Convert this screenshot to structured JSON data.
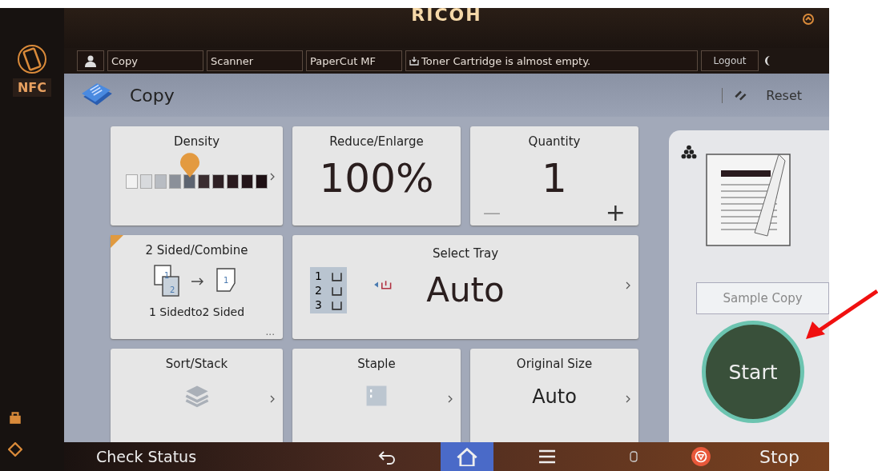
{
  "brand": "RICOH",
  "nfc": {
    "label": "NFC"
  },
  "header": {
    "tabs": [
      {
        "label": "Copy",
        "selected": false
      },
      {
        "label": "Scanner",
        "selected": false
      },
      {
        "label": "PaperCut MF",
        "selected": false
      }
    ],
    "message": "Toner Cartridge is almost empty.",
    "logout": "Logout"
  },
  "title": "Copy",
  "reset": "Reset",
  "tiles": [
    {
      "kind": "density",
      "label": "Density",
      "level": 0.45
    },
    {
      "kind": "zoom",
      "label": "Reduce/Enlarge",
      "value": "100%"
    },
    {
      "kind": "quantity",
      "label": "Quantity",
      "value": "1",
      "minus": "—",
      "plus": "+"
    },
    {
      "kind": "duplex",
      "label": "2 Sided/Combine",
      "value": "1 Sidedto2 Sided",
      "pages": [
        "1",
        "2",
        "1"
      ],
      "more": "..."
    },
    {
      "kind": "tray",
      "label": "Select Tray",
      "value": "Auto",
      "trays": [
        "1",
        "2",
        "3"
      ]
    },
    {
      "kind": "sort",
      "label": "Sort/Stack"
    },
    {
      "kind": "staple",
      "label": "Staple"
    },
    {
      "kind": "size",
      "label": "Original Size",
      "value": "Auto"
    }
  ],
  "sample_copy": "Sample Copy",
  "start": "Start",
  "bottom": {
    "check_status": "Check Status",
    "nav": [
      {
        "kind": "back",
        "selected": false
      },
      {
        "kind": "home",
        "selected": true
      },
      {
        "kind": "menu",
        "selected": false
      }
    ],
    "stop": "Stop"
  }
}
